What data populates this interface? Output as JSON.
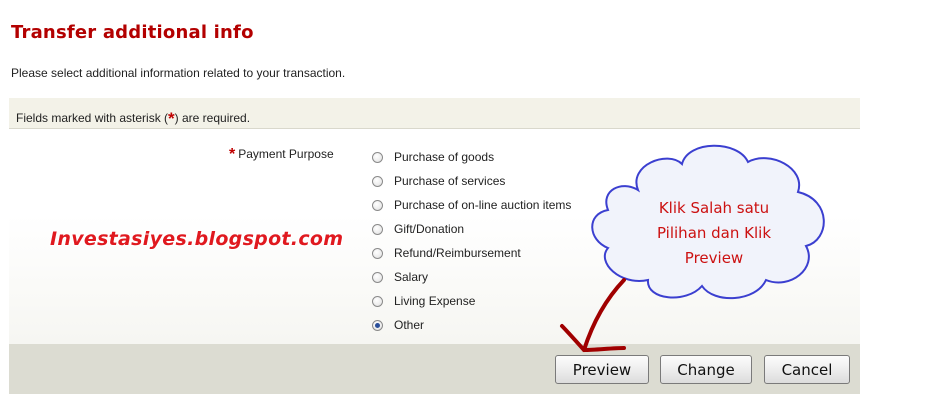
{
  "page_title": "Transfer additional info",
  "intro_text": "Please select additional information related to your transaction.",
  "required_notice": {
    "before": "Fields marked with asterisk (",
    "star": "*",
    "after": ") are required."
  },
  "payment_purpose": {
    "star": "*",
    "label": "Payment Purpose",
    "selected": "Other",
    "options": [
      "Purchase of goods",
      "Purchase of services",
      "Purchase of on-line auction items",
      "Gift/Donation",
      "Refund/Reimbursement",
      "Salary",
      "Living Expense",
      "Other"
    ]
  },
  "buttons": {
    "preview": "Preview",
    "change": "Change",
    "cancel": "Cancel"
  },
  "annotation": {
    "watermark": "Investasiyes.blogspot.com",
    "cloud_lines": [
      "Klik Salah satu",
      "Pilihan dan Klik",
      "Preview"
    ]
  },
  "colors": {
    "title": "#b30000",
    "asterisk": "#c00000",
    "annotation_red": "#cc1111",
    "cloud_fill": "#f1f3fb",
    "cloud_stroke": "#3b3fd0",
    "arrow": "#a00000"
  }
}
